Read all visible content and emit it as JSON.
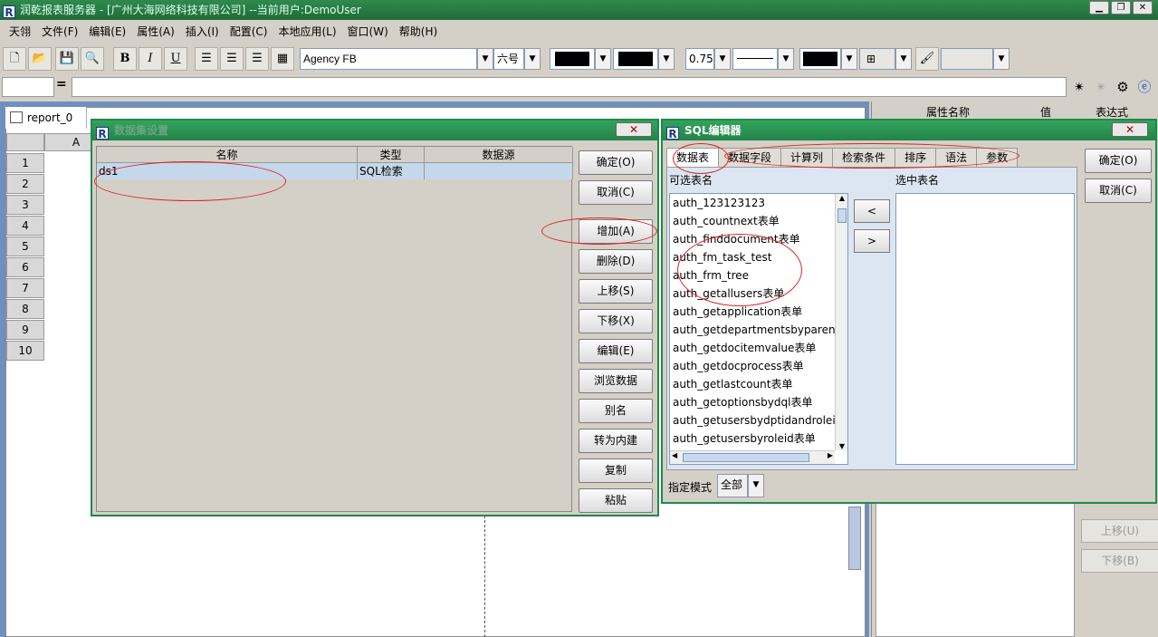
{
  "window": {
    "title": "润乾报表服务器 - [广州大海网络科技有限公司]  --当前用户:DemoUser"
  },
  "menu": [
    "天翎",
    "文件(F)",
    "编辑(E)",
    "属性(A)",
    "插入(I)",
    "配置(C)",
    "本地应用(L)",
    "窗口(W)",
    "帮助(H)"
  ],
  "toolbar": {
    "bold": "B",
    "italic": "I",
    "underline": "U",
    "font": "Agency FB",
    "size": "六号",
    "line_width": "0.75"
  },
  "formula_bar": {
    "equals": "="
  },
  "document": {
    "tab": "report_0",
    "column": "A",
    "rows": [
      "1",
      "2",
      "3",
      "4",
      "5",
      "6",
      "7",
      "8",
      "9",
      "10"
    ]
  },
  "right_panel": {
    "headers": [
      "属性名称",
      "值",
      "表达式"
    ],
    "buttons": [
      "上移(U)",
      "下移(B)"
    ]
  },
  "dataset_dialog": {
    "title": "数据集设置",
    "columns": [
      "名称",
      "类型",
      "数据源"
    ],
    "rows": [
      {
        "name": "ds1",
        "type": "SQL检索",
        "source": ""
      }
    ],
    "buttons": [
      "确定(O)",
      "取消(C)",
      "增加(A)",
      "删除(D)",
      "上移(S)",
      "下移(X)",
      "编辑(E)",
      "浏览数据",
      "别名",
      "转为内建",
      "复制",
      "粘贴"
    ]
  },
  "sql_editor": {
    "title": "SQL编辑器",
    "tabs": [
      "数据表",
      "数据字段",
      "计算列",
      "检索条件",
      "排序",
      "语法",
      "参数"
    ],
    "available_label": "可选表名",
    "selected_label": "选中表名",
    "tables": [
      "auth_123123123",
      "auth_countnext表单",
      "auth_finddocument表单",
      "auth_fm_task_test",
      "auth_frm_tree",
      "auth_getallusers表单",
      "auth_getapplication表单",
      "auth_getdepartmentsbyparent表单",
      "auth_getdocitemvalue表单",
      "auth_getdocprocess表单",
      "auth_getlastcount表单",
      "auth_getoptionsbydql表单",
      "auth_getusersbydptidandroleid表单",
      "auth_getusersbyroleid表单"
    ],
    "move_left": "<",
    "move_right": ">",
    "ok": "确定(O)",
    "cancel": "取消(C)",
    "mode_label": "指定模式",
    "mode_value": "全部"
  }
}
